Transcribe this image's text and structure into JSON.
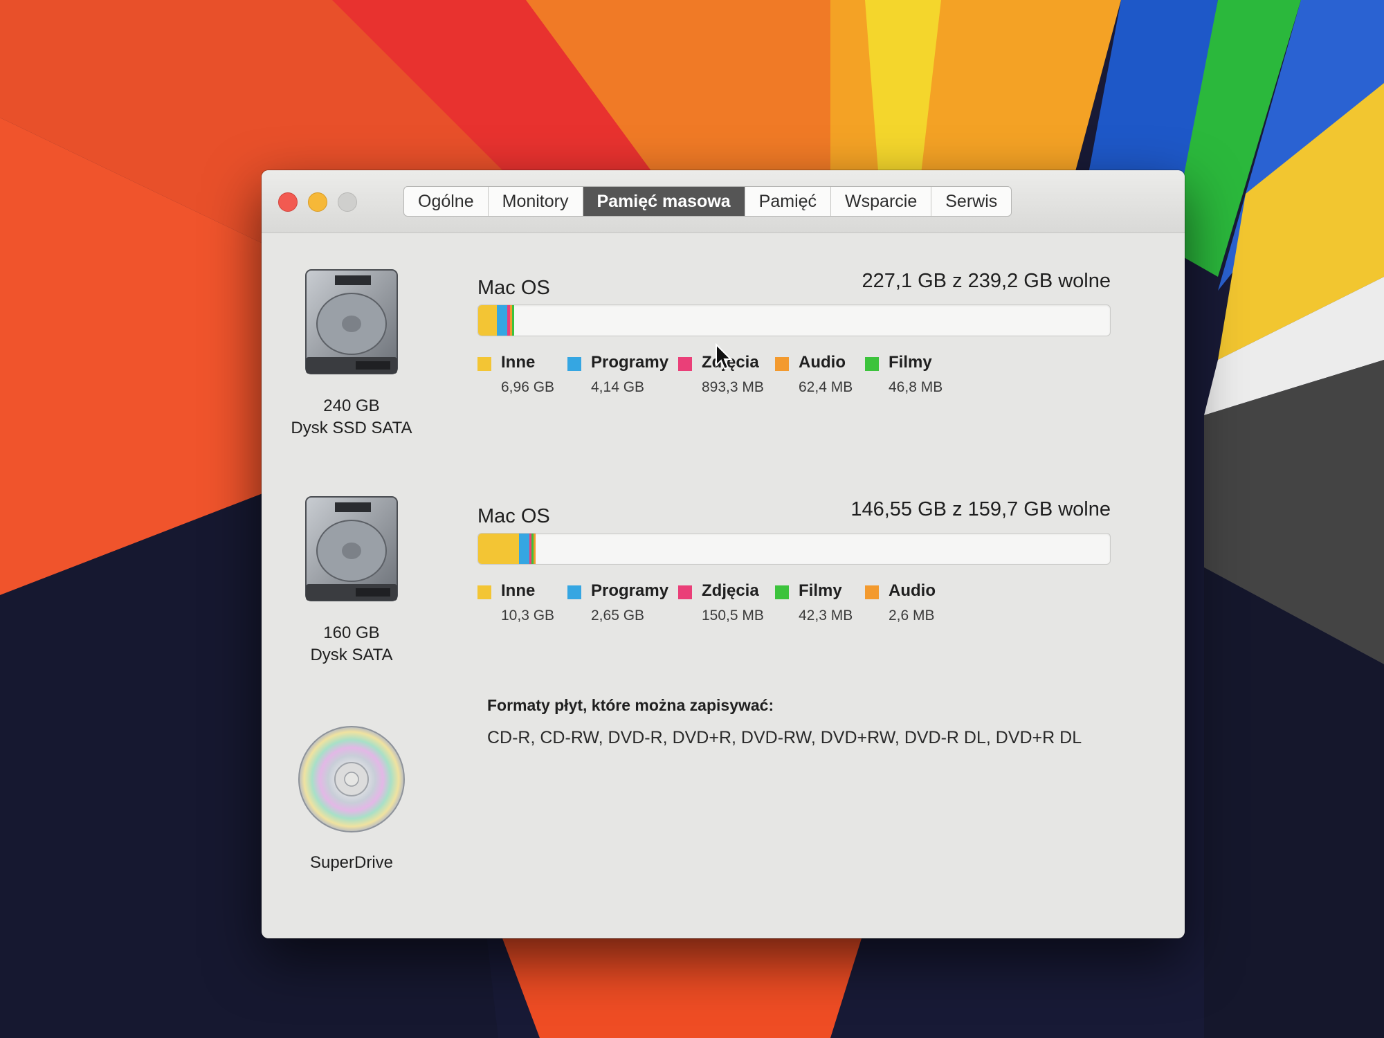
{
  "window": {
    "tabs": [
      {
        "label": "Ogólne"
      },
      {
        "label": "Monitory"
      },
      {
        "label": "Pamięć masowa",
        "active": true
      },
      {
        "label": "Pamięć"
      },
      {
        "label": "Wsparcie"
      },
      {
        "label": "Serwis"
      }
    ]
  },
  "colors": {
    "inne": "#f3c534",
    "programy": "#35a6e2",
    "zdjecia": "#ea3f78",
    "audio": "#f39a2e",
    "filmy": "#3cc33c"
  },
  "disks": [
    {
      "icon": "hard-drive-icon",
      "capacity": "240 GB",
      "type": "Dysk SSD SATA",
      "volume": {
        "name": "Mac OS",
        "free_text": "227,1 GB z 239,2 GB wolne",
        "total_gb": 239.2,
        "categories": [
          {
            "name": "Inne",
            "size": "6,96 GB",
            "gb": 6.96,
            "color": "#f3c534"
          },
          {
            "name": "Programy",
            "size": "4,14 GB",
            "gb": 4.14,
            "color": "#35a6e2"
          },
          {
            "name": "Zdjęcia",
            "size": "893,3 MB",
            "gb": 0.8933,
            "color": "#ea3f78"
          },
          {
            "name": "Audio",
            "size": "62,4 MB",
            "gb": 0.0624,
            "color": "#f39a2e"
          },
          {
            "name": "Filmy",
            "size": "46,8 MB",
            "gb": 0.0468,
            "color": "#3cc33c"
          }
        ]
      }
    },
    {
      "icon": "hard-drive-icon",
      "capacity": "160 GB",
      "type": "Dysk SATA",
      "volume": {
        "name": "Mac OS",
        "free_text": "146,55 GB z 159,7 GB wolne",
        "total_gb": 159.7,
        "categories": [
          {
            "name": "Inne",
            "size": "10,3 GB",
            "gb": 10.3,
            "color": "#f3c534"
          },
          {
            "name": "Programy",
            "size": "2,65 GB",
            "gb": 2.65,
            "color": "#35a6e2"
          },
          {
            "name": "Zdjęcia",
            "size": "150,5 MB",
            "gb": 0.1505,
            "color": "#ea3f78"
          },
          {
            "name": "Filmy",
            "size": "42,3 MB",
            "gb": 0.0423,
            "color": "#3cc33c"
          },
          {
            "name": "Audio",
            "size": "2,6 MB",
            "gb": 0.0026,
            "color": "#f39a2e"
          }
        ]
      }
    }
  ],
  "superdrive": {
    "icon": "optical-disc-icon",
    "label": "SuperDrive",
    "formats_title": "Formaty płyt, które można zapisywać:",
    "formats": "CD-R, CD-RW, DVD-R, DVD+R, DVD-RW, DVD+RW, DVD-R DL, DVD+R DL"
  }
}
